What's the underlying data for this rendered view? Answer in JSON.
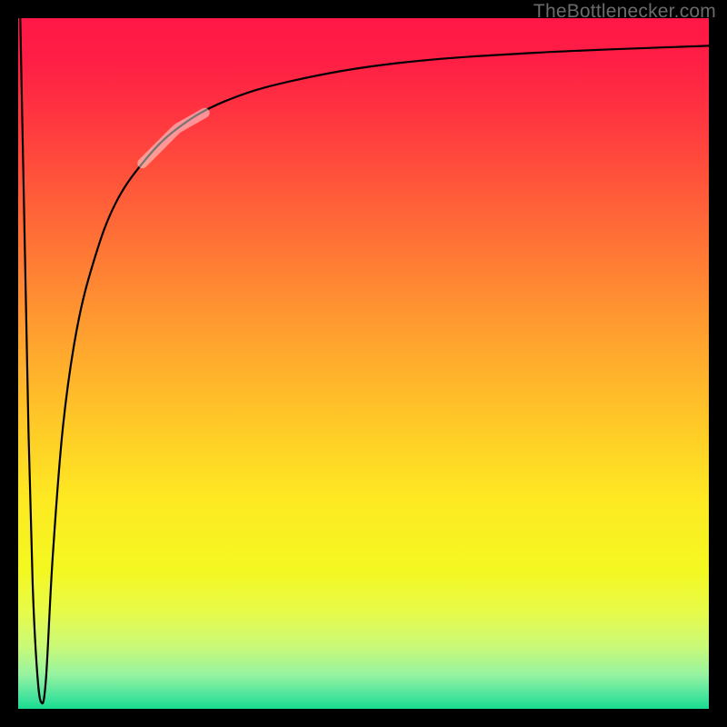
{
  "watermark": {
    "text": "TheBottlenecker.com"
  },
  "chart_data": {
    "type": "line",
    "title": "",
    "xlabel": "",
    "ylabel": "",
    "xlim": [
      0,
      100
    ],
    "ylim": [
      0,
      100
    ],
    "grid": false,
    "series": [
      {
        "name": "bottleneck-curve",
        "x": [
          0.3,
          0.9,
          1.5,
          2.1,
          2.7,
          3.3,
          4.0,
          5.0,
          6.5,
          8.5,
          11,
          14,
          18,
          23,
          30,
          40,
          55,
          75,
          100
        ],
        "values": [
          100,
          70,
          40,
          18,
          6,
          1,
          4,
          22,
          41,
          55,
          65,
          73,
          79,
          84,
          88,
          91,
          93.5,
          95,
          96
        ]
      }
    ],
    "highlight_segment": {
      "x_start": 18,
      "x_end": 27,
      "note": "faded overlay stroke on curve"
    },
    "gradient_stops": [
      {
        "pos": 0.0,
        "color": "#ff1846"
      },
      {
        "pos": 0.3,
        "color": "#ff6a37"
      },
      {
        "pos": 0.58,
        "color": "#ffc728"
      },
      {
        "pos": 0.8,
        "color": "#f4f821"
      },
      {
        "pos": 0.95,
        "color": "#97f3a0"
      },
      {
        "pos": 1.0,
        "color": "#17dc8f"
      }
    ]
  }
}
